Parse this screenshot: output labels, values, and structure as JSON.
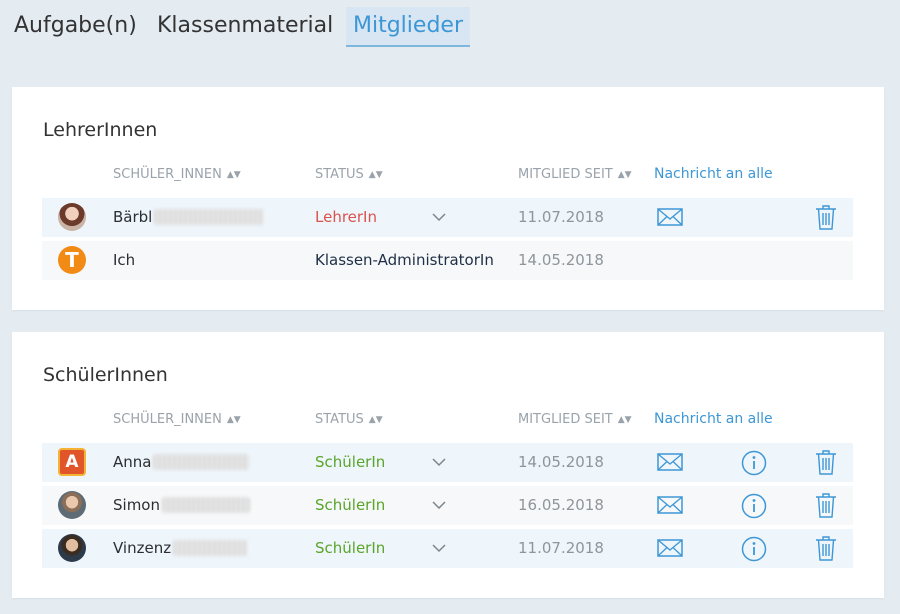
{
  "tabs": [
    {
      "label": "Aufgabe(n)"
    },
    {
      "label": "Klassenmaterial"
    },
    {
      "label": "Mitglieder"
    }
  ],
  "teachers": {
    "title": "LehrerInnen",
    "columns": {
      "name": "SCHÜLER_INNEN",
      "status": "STATUS",
      "since": "MITGLIED SEIT",
      "message_all": "Nachricht an alle"
    },
    "rows": [
      {
        "name": "Bärbl",
        "status": "LehrerIn",
        "since": "11.07.2018"
      },
      {
        "name": "Ich",
        "status": "Klassen-AdministratorIn",
        "since": "14.05.2018",
        "avatar_letter": "T"
      }
    ]
  },
  "students": {
    "title": "SchülerInnen",
    "columns": {
      "name": "SCHÜLER_INNEN",
      "status": "STATUS",
      "since": "MITGLIED SEIT",
      "message_all": "Nachricht an alle"
    },
    "rows": [
      {
        "name": "Anna",
        "status": "SchülerIn",
        "since": "14.05.2018",
        "avatar_letter": "A"
      },
      {
        "name": "Simon",
        "status": "SchülerIn",
        "since": "16.05.2018"
      },
      {
        "name": "Vinzenz",
        "status": "SchülerIn",
        "since": "11.07.2018"
      }
    ]
  },
  "icons": {
    "sort": "sort-updown-icon",
    "chevron": "chevron-down-icon",
    "mail": "envelope-icon",
    "info": "info-circle-icon",
    "trash": "trash-icon"
  },
  "colors": {
    "accent": "#3d97d6",
    "teacher_status": "#d9534f",
    "student_status": "#5aa52a",
    "admin_status": "#1f2f45",
    "background": "#e4ebf1"
  }
}
